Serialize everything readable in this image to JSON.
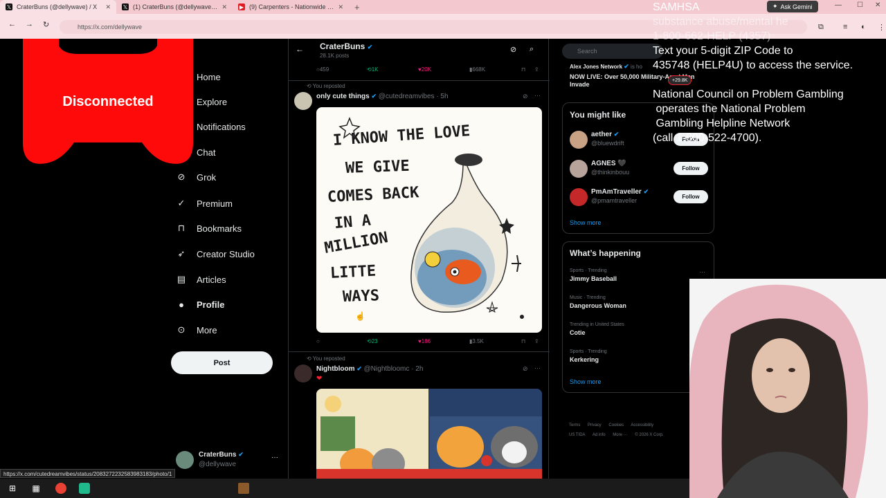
{
  "browser": {
    "tabs": [
      {
        "title": "CraterBuns (@dellywave) / X",
        "icon": "x-logo-icon"
      },
      {
        "title": "(1) CraterBuns (@dellywave) / X",
        "icon": "x-logo-icon"
      },
      {
        "title": "(9) Carpenters - Nationwide Int...",
        "icon": "youtube-icon"
      }
    ],
    "new_tab": "+",
    "gemini_label": "Ask Gemini",
    "url": "https://x.com/dellywave",
    "status_url": "https://x.com/cutedreamvibes/status/2083272232583983183/photo/1"
  },
  "overlay": {
    "disconnected_label": "Disconnected",
    "help_lines": [
      "SAMHSA",
      "substance abuse/mental he",
      "1-800-662-HELP (4357)",
      "Text your 5-digit ZIP Code to",
      "435748 (HELP4U) to access the service.",
      "National Council on Problem Gambling",
      " operates the National Problem",
      " Gambling Helpline Network",
      "(call 1-800-522-4700)."
    ]
  },
  "left_nav": {
    "logo": "X",
    "items": [
      {
        "label": "Home",
        "icon": "home-icon"
      },
      {
        "label": "Explore",
        "icon": "search-icon"
      },
      {
        "label": "Notifications",
        "icon": "bell-icon"
      },
      {
        "label": "Chat",
        "icon": "chat-icon"
      },
      {
        "label": "Grok",
        "icon": "grok-icon"
      },
      {
        "label": "Premium",
        "icon": "premium-icon"
      },
      {
        "label": "Bookmarks",
        "icon": "bookmark-icon"
      },
      {
        "label": "Creator Studio",
        "icon": "rocket-icon"
      },
      {
        "label": "Articles",
        "icon": "articles-icon"
      },
      {
        "label": "Profile",
        "icon": "person-icon"
      },
      {
        "label": "More",
        "icon": "more-circle-icon"
      }
    ],
    "post_label": "Post",
    "account": {
      "name": "CraterBuns",
      "handle": "@dellywave",
      "more": "···"
    }
  },
  "profile_header": {
    "name": "CraterBuns",
    "post_count": "28.1K posts"
  },
  "top_actions": {
    "replies": "459",
    "reposts": "1K",
    "likes": "20K",
    "views": "668K"
  },
  "posts": [
    {
      "repost_label": "You reposted",
      "author": "only cute things",
      "handle": "@cutedreamvibes",
      "time": "· 5h",
      "image_text": [
        "I KNOW THE LOVE",
        "WE GIVE",
        "COMES BACK",
        "IN A",
        "MILLION",
        "LITTE",
        "WAYS"
      ],
      "actions": {
        "replies": "",
        "reposts": "23",
        "likes": "186",
        "views": "3.5K"
      }
    },
    {
      "repost_label": "You reposted",
      "author": "Nightbloom",
      "handle": "@Nightbloomc",
      "time": "· 2h",
      "body": "❤"
    }
  ],
  "right_col": {
    "search_placeholder": "Search",
    "live": {
      "account": "Alex Jones Network",
      "suffix": "is ho",
      "headline": "NOW LIVE: Over 50,000 Military-Aged Men Invade",
      "badge": "+29.8K"
    },
    "who_to_follow": {
      "title": "You might like",
      "accounts": [
        {
          "name": "aether",
          "handle": "@bluewdrift",
          "button": "Follow"
        },
        {
          "name": "AGNES 🖤",
          "handle": "@thinkinbouu",
          "button": "Follow"
        },
        {
          "name": "PmAmTraveller",
          "handle": "@pmamtraveller",
          "button": "Follow"
        }
      ],
      "show_more": "Show more"
    },
    "trends": {
      "title": "What’s happening",
      "items": [
        {
          "meta": "Sports · Trending",
          "topic": "Jimmy Baseball"
        },
        {
          "meta": "Music · Trending",
          "topic": "Dangerous Woman"
        },
        {
          "meta": "Trending in United States",
          "topic": "Cotie"
        },
        {
          "meta": "Sports · Trending",
          "topic": "Kerkering"
        }
      ],
      "show_more": "Show more"
    },
    "footer": [
      "Terms",
      "Privacy",
      "Cookies",
      "Accessibility",
      "US TIDA",
      "Ad info",
      "More ···",
      "© 2026 X Corp."
    ]
  }
}
